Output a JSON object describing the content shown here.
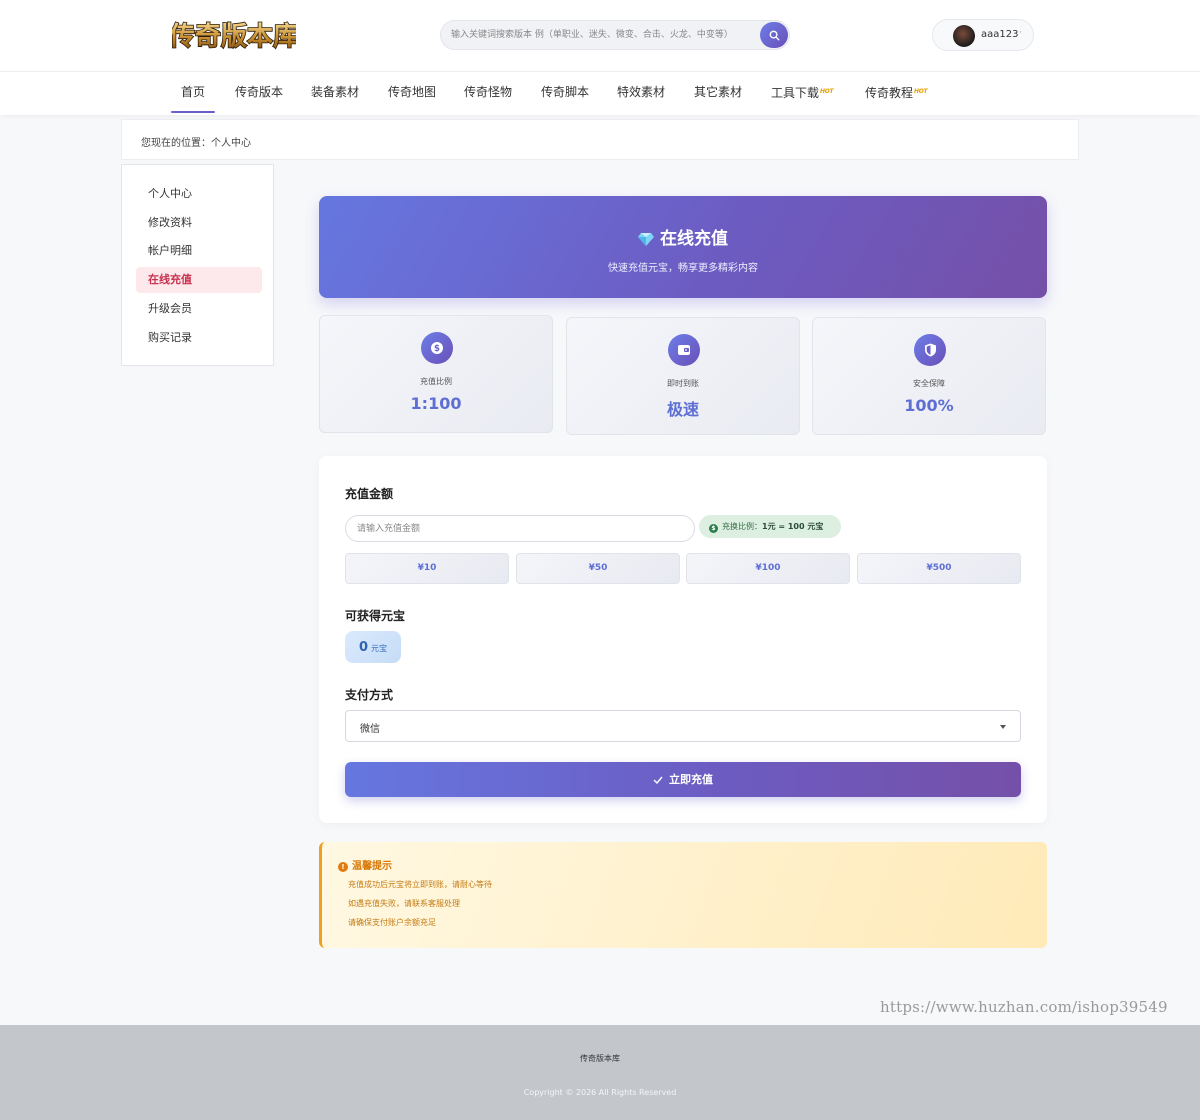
{
  "header": {
    "logo_text": "传奇版本库",
    "search_placeholder": "输入关键词搜索版本 例（单职业、迷失、微变、合击、火龙、中变等）",
    "username": "aaa123"
  },
  "nav": [
    {
      "label": "首页",
      "hot": false,
      "active": true
    },
    {
      "label": "传奇版本",
      "hot": false
    },
    {
      "label": "装备素材",
      "hot": false
    },
    {
      "label": "传奇地图",
      "hot": false
    },
    {
      "label": "传奇怪物",
      "hot": false
    },
    {
      "label": "传奇脚本",
      "hot": false
    },
    {
      "label": "特效素材",
      "hot": false
    },
    {
      "label": "其它素材",
      "hot": false
    },
    {
      "label": "工具下载",
      "hot": true
    },
    {
      "label": "传奇教程",
      "hot": true
    }
  ],
  "hot_label": "HOT",
  "breadcrumb": "您现在的位置：个人中心",
  "sidebar": [
    {
      "label": "个人中心"
    },
    {
      "label": "修改资料"
    },
    {
      "label": "帐户明细"
    },
    {
      "label": "在线充值",
      "active": true
    },
    {
      "label": "升级会员"
    },
    {
      "label": "购买记录"
    }
  ],
  "hero": {
    "title": "在线充值",
    "subtitle": "快速充值元宝，畅享更多精彩内容"
  },
  "stats": [
    {
      "label": "充值比例",
      "value": "1:100",
      "icon": "dollar-coin-icon"
    },
    {
      "label": "即时到账",
      "value": "极速",
      "icon": "wallet-icon"
    },
    {
      "label": "安全保障",
      "value": "100%",
      "icon": "shield-icon"
    }
  ],
  "form": {
    "amount_title": "充值金额",
    "amount_placeholder": "请输入充值金额",
    "ratio_prefix": "充换比例：",
    "ratio_value": "1元 = 100 元宝",
    "presets": [
      "¥10",
      "¥50",
      "¥100",
      "¥500"
    ],
    "gain_title": "可获得元宝",
    "gain_value": "0",
    "gain_unit": "元宝",
    "pay_title": "支付方式",
    "pay_selected": "微信",
    "submit_label": "立即充值"
  },
  "tips": {
    "title": "温馨提示",
    "lines": [
      "充值成功后元宝将立即到账，请耐心等待",
      "如遇充值失败，请联系客服处理",
      "请确保支付账户余额充足"
    ]
  },
  "watermark": "https://www.huzhan.com/ishop39549",
  "footer": {
    "name": "传奇版本库",
    "copyright": "Copyright © 2026 All Rights Reserved"
  },
  "colors": {
    "accent": "#6a5fc9",
    "accent_blue": "#6677e0",
    "accent_purple": "#7550a8",
    "sidebar_active_bg": "#fde8ec",
    "sidebar_active_text": "#c8324f",
    "tips_text": "#d87a0a"
  }
}
